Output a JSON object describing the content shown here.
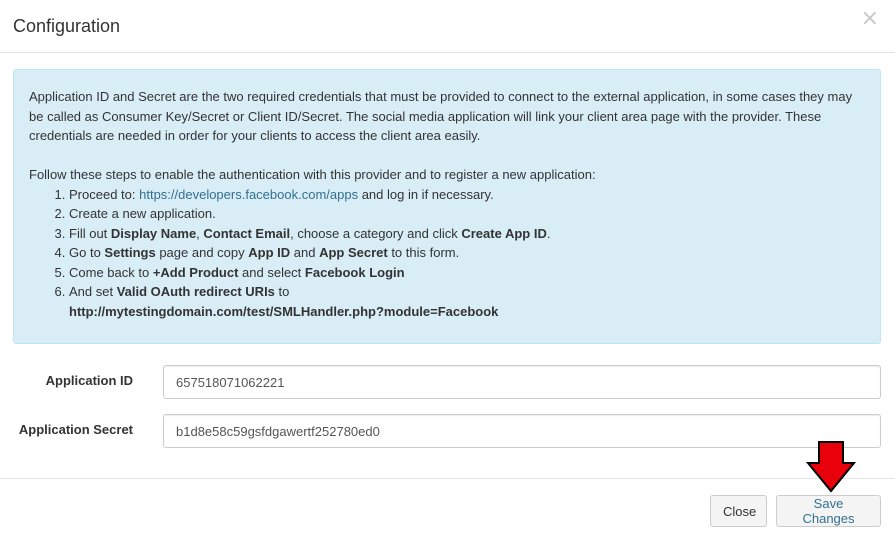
{
  "modal": {
    "title": "Configuration",
    "close_glyph": "×"
  },
  "alert": {
    "intro": "Application ID and Secret are the two required credentials that must be provided to connect to the external application, in some cases they may be called as Consumer Key/Secret or Client ID/Secret. The social media application will link your client area page with the provider. These credentials are needed in order for your clients to access the client area easily.",
    "steps_intro": "Follow these steps to enable the authentication with this provider and to register a new application:",
    "step1_prefix": "Proceed to: ",
    "step1_link": "https://developers.facebook.com/apps",
    "step1_suffix": " and log in if necessary.",
    "step2": "Create a new application.",
    "step3_a": "Fill out ",
    "step3_b": "Display Name",
    "step3_c": ", ",
    "step3_d": "Contact Email",
    "step3_e": ", choose a category and click ",
    "step3_f": "Create App ID",
    "step3_g": ".",
    "step4_a": "Go to ",
    "step4_b": "Settings",
    "step4_c": " page and copy ",
    "step4_d": "App ID",
    "step4_e": " and ",
    "step4_f": "App Secret",
    "step4_g": " to this form.",
    "step5_a": "Come back to ",
    "step5_b": "+Add Product",
    "step5_c": " and select ",
    "step5_d": "Facebook Login",
    "step6_a": "And set ",
    "step6_b": "Valid OAuth redirect URIs",
    "step6_c": " to",
    "step6_url": "http://mytestingdomain.com/test/SMLHandler.php?module=Facebook"
  },
  "form": {
    "app_id_label": "Application ID",
    "app_id_value": "657518071062221",
    "app_secret_label": "Application Secret",
    "app_secret_value": "b1d8e58c59gsfdgawertf252780ed0"
  },
  "footer": {
    "close_label": "Close",
    "save_label": "Save Changes"
  },
  "colors": {
    "alert_bg": "#d9edf7",
    "alert_border": "#bce8f1",
    "link": "#31708f",
    "arrow": "#e8000b"
  },
  "icons": {
    "annotation": "red-down-arrow"
  }
}
